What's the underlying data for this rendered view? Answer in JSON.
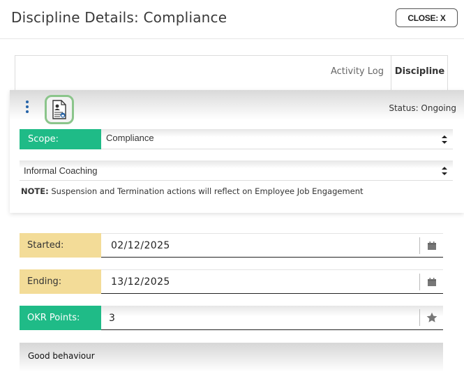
{
  "header": {
    "title": "Discipline Details: Compliance",
    "close_label": "CLOSE: X"
  },
  "tabs": [
    {
      "label": "Activity Log",
      "active": false
    },
    {
      "label": "Discipline",
      "active": true
    }
  ],
  "toolbar": {
    "status_text": "Status: Ongoing"
  },
  "form": {
    "scope_label": "Scope:",
    "scope_value": "Compliance",
    "action_value": "Informal Coaching",
    "note_prefix": "NOTE:",
    "note_text": " Suspension and Termination actions will reflect on Employee Job Engagement",
    "started_label": "Started:",
    "started_value": "02/12/2025",
    "ending_label": "Ending:",
    "ending_value": "13/12/2025",
    "okr_label": "OKR Points:",
    "okr_value": "3",
    "comment_value": "Good behaviour"
  },
  "colors": {
    "green_label": "#1fbb87",
    "yellow_label": "#f3dc98",
    "icon_border": "#8bc58b",
    "kebab": "#2563a8"
  },
  "icons": [
    "kebab-menu-icon",
    "document-user-icon",
    "select-arrows-icon",
    "calendar-icon",
    "star-icon"
  ]
}
